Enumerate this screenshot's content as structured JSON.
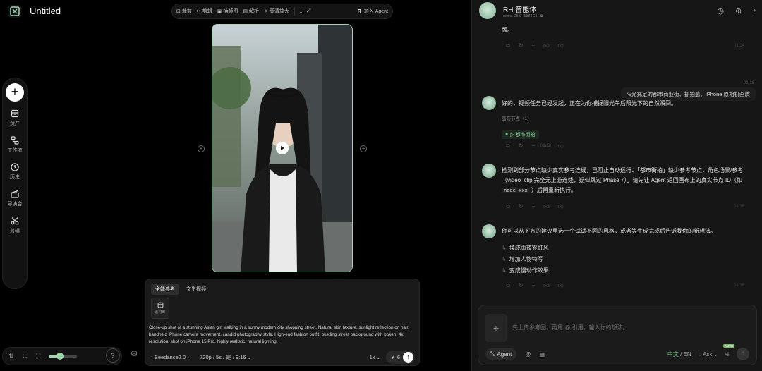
{
  "app": {
    "title": "Untitled"
  },
  "toolbar": {
    "items": [
      "裁剪",
      "剪辑",
      "抽帧图",
      "解析",
      "高清放大"
    ],
    "agent_label": "加入 Agent"
  },
  "rail": {
    "items": [
      "资产",
      "工作流",
      "历史",
      "导演台",
      "剪辑"
    ]
  },
  "prompt_panel": {
    "tabs": [
      "全能参考",
      "文生视频"
    ],
    "material_label": "素材库",
    "text": "Close-up shot of a stunning Asian girl walking in a sunny modern city shopping street. Natural skin texture, sunlight reflection on hair, handheld iPhone camera movement, candid photography style. High-end fashion outfit, bustling street background with bokeh, 4k resolution, shot on iPhone 15 Pro, highly realistic, natural lighting.",
    "model": "Seedance2.0",
    "spec": "720p / 5s / 是 / 9:16",
    "count": "1x",
    "cost": "6"
  },
  "colors": {
    "accent": "#9fd6b0",
    "canvas_bg": "#000000",
    "panel_bg": "#161616"
  },
  "bottom_bar": {
    "zoom": 0.4
  },
  "chat": {
    "agent_name": "RH 智能体",
    "meta_a": "xxxxx-25S",
    "meta_b": "1584C1",
    "msg0_text": "版。",
    "msg0_time": "01:14",
    "user_msg": "阳光充足的都市商业街、抓拍感、iPhone 原相机画质",
    "user_time": "01:18",
    "msg1_text": "好的，视频任务已经发起，正在为你捕捉阳光午后阳光下的自然瞬间。",
    "msg1_sub": "画布节点（1）",
    "msg1_chip": "▷ 都市街拍",
    "msg1_time": "01:18",
    "msg2_text_a": "检测到部分节点缺少真实参考连线，已阻止自动运行：「都市街拍」缺少参考节点：角色场景/参考（video_clip 完全无上游连线，疑似跳过 Phase 7）。请先让 Agent 返回画布上的真实节点 ID（如",
    "msg2_code": "node-xxx",
    "msg2_text_b": "）后再重新执行。",
    "msg2_time": "01:18",
    "msg3_text": "你可以从下方的建议里选一个试试不同的风格，或者等生成完成后告诉我你的新想法。",
    "suggestions": [
      "换成雨夜霓虹风",
      "增加人物特写",
      "变成慢动作效果"
    ],
    "msg3_time": "01:18"
  },
  "composer": {
    "placeholder": "先上传参考图，再用 @ 引用，输入你的想法。",
    "agent_label": "Agent",
    "lang_zh": "中文",
    "lang_sep": "/",
    "lang_en": "EN",
    "ask_label": "Ask",
    "auto_badge": "AUTO"
  }
}
